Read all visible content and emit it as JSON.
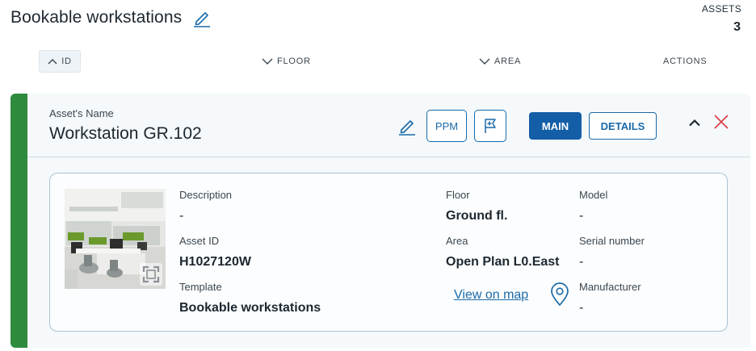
{
  "header": {
    "title": "Bookable workstations",
    "assets_label": "ASSETS",
    "assets_count": "3"
  },
  "sort": {
    "id": "ID",
    "floor": "FLOOR",
    "area": "AREA",
    "actions": "ACTIONS"
  },
  "card": {
    "name_label": "Asset's Name",
    "name": "Workstation GR.102",
    "ppm_label": "PPM",
    "main_label": "MAIN",
    "details_label": "DETAILS",
    "fields": {
      "description_label": "Description",
      "description_value": "-",
      "asset_id_label": "Asset ID",
      "asset_id_value": "H1027120W",
      "template_label": "Template",
      "template_value": "Bookable workstations",
      "floor_label": "Floor",
      "floor_value": "Ground fl.",
      "area_label": "Area",
      "area_value": "Open Plan L0.East",
      "model_label": "Model",
      "model_value": "-",
      "serial_label": "Serial number",
      "serial_value": "-",
      "manufacturer_label": "Manufacturer",
      "manufacturer_value": "-"
    },
    "view_map_label": "View on map"
  },
  "colors": {
    "status_stripe": "#2e8b3e",
    "primary": "#145ea8",
    "close": "#d9434a"
  },
  "icons": [
    "pencil-icon",
    "chevron-up-icon",
    "chevron-down-icon",
    "flag-icon",
    "close-icon",
    "expand-icon",
    "map-pin-icon"
  ]
}
